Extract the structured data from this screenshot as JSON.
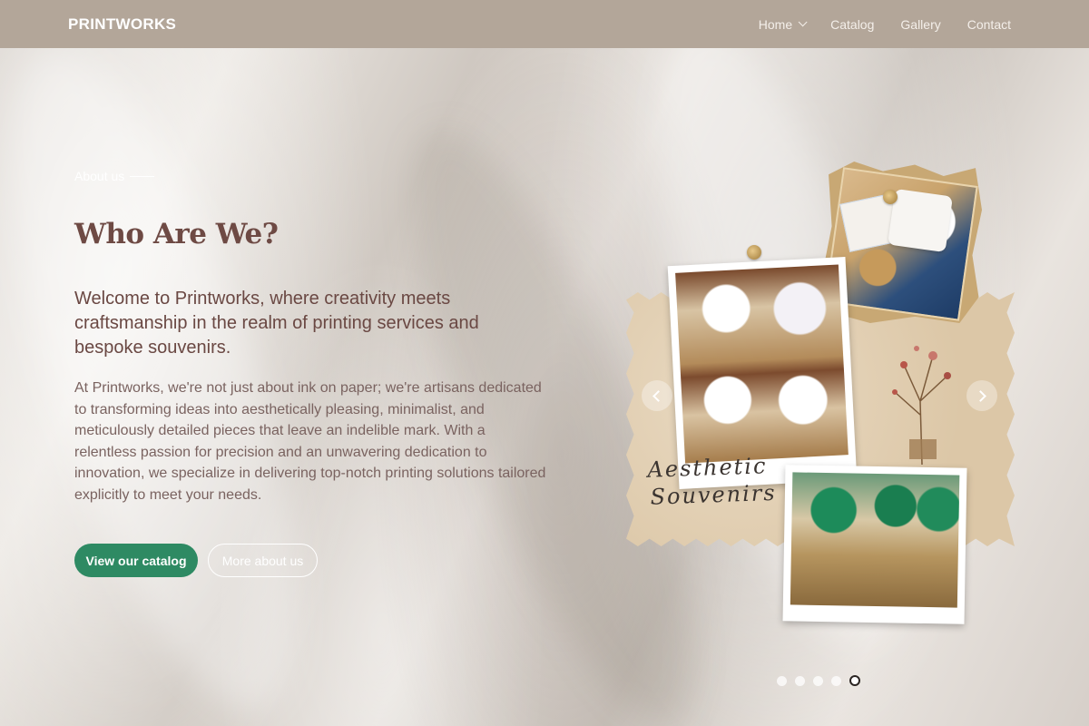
{
  "navbar": {
    "brand": "PRINTWORKS",
    "links": [
      {
        "label": "Home",
        "has_dropdown": true
      },
      {
        "label": "Catalog"
      },
      {
        "label": "Gallery"
      },
      {
        "label": "Contact"
      }
    ]
  },
  "hero": {
    "eyebrow": "About us",
    "title": "Who Are We?",
    "lead": "Welcome to Printworks, where creativity meets craftsmanship in the realm of printing services and bespoke souvenirs.",
    "body": "At Printworks, we're not just about ink on paper; we're artisans dedicated to transforming ideas into aesthetically pleasing, minimalist, and meticulously detailed pieces that leave an indelible mark. With a relentless passion for precision and an unwavering dedication to innovation, we specialize in delivering top-notch printing solutions tailored explicitly to meet your needs.",
    "primary_button": "View our catalog",
    "secondary_button": "More about us"
  },
  "carousel": {
    "script_line_1": "Aesthetic",
    "script_line_2": "Souvenirs",
    "slide_count": 5,
    "active_slide": 5,
    "prev_icon": "chevron-left-icon",
    "next_icon": "chevron-right-icon"
  },
  "colors": {
    "navbar": "#b3a699",
    "title": "#6e4a44",
    "primary_button": "#2e8a63"
  }
}
